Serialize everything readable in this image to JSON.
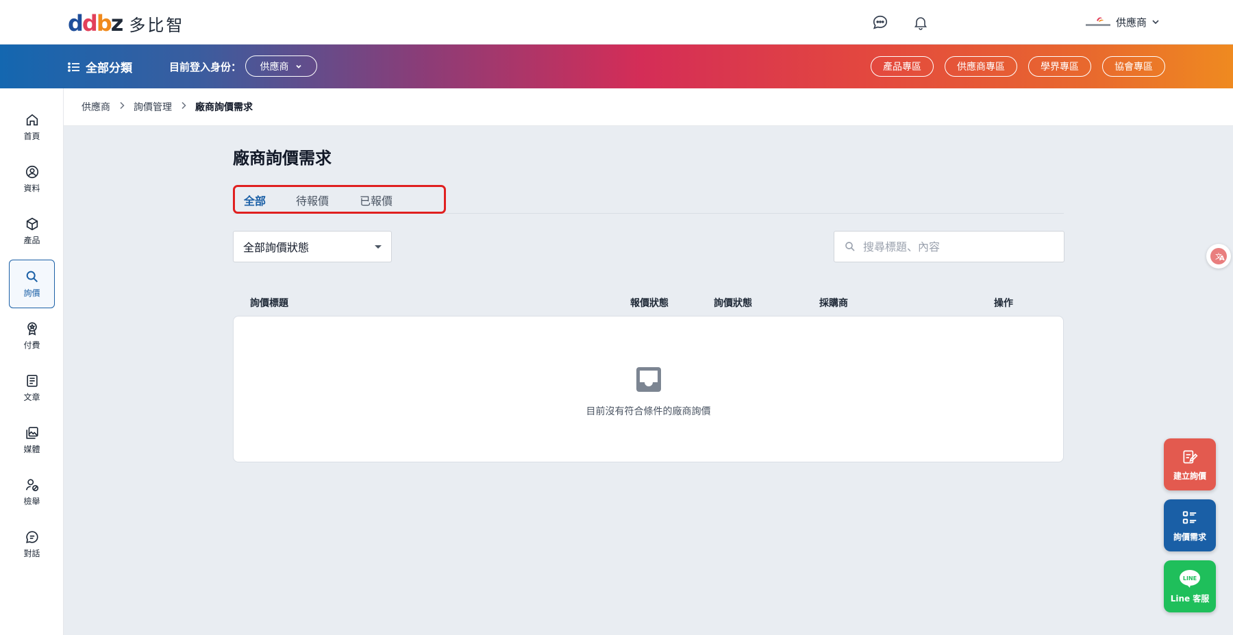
{
  "brand": {
    "logo_mark": "ddbz",
    "name": "多比智"
  },
  "header": {
    "user_name": "供應商",
    "icons": [
      "chat-icon",
      "bell-icon",
      "chevron-down-icon"
    ]
  },
  "band": {
    "categories_label": "全部分類",
    "role_label": "目前登入身份：",
    "role_value": "供應商",
    "pills": [
      "產品專區",
      "供應商專區",
      "學界專區",
      "協會專區"
    ]
  },
  "sidebar": {
    "items": [
      {
        "label": "首頁",
        "icon": "home-icon"
      },
      {
        "label": "資料",
        "icon": "user-circle-icon"
      },
      {
        "label": "產品",
        "icon": "box-icon"
      },
      {
        "label": "詢價",
        "icon": "search-icon",
        "active": true
      },
      {
        "label": "付費",
        "icon": "badge-icon"
      },
      {
        "label": "文章",
        "icon": "article-icon"
      },
      {
        "label": "媒體",
        "icon": "media-icon"
      },
      {
        "label": "檢舉",
        "icon": "report-user-icon"
      },
      {
        "label": "對話",
        "icon": "chat-bubble-icon"
      }
    ]
  },
  "breadcrumb": [
    "供應商",
    "詢價管理",
    "廠商詢價需求"
  ],
  "main": {
    "title": "廠商詢價需求",
    "tabs": [
      {
        "label": "全部",
        "active": true
      },
      {
        "label": "待報價"
      },
      {
        "label": "已報價"
      }
    ],
    "status_filter": "全部詢價狀態",
    "search_placeholder": "搜尋標題、內容",
    "table": {
      "columns": [
        "詢價標題",
        "報價狀態",
        "詢價狀態",
        "採購商",
        "操作"
      ],
      "rows": [],
      "empty_text": "目前沒有符合條件的廠商詢價"
    }
  },
  "fabs": {
    "create_label": "建立詢價",
    "requests_label": "詢價需求",
    "line_label": "Line 客服",
    "line_icon_text": "LINE"
  },
  "colors": {
    "accent": "#1a5fa6",
    "highlight": "#e02020",
    "create": "#e35a4f",
    "line": "#1fbf5b"
  }
}
